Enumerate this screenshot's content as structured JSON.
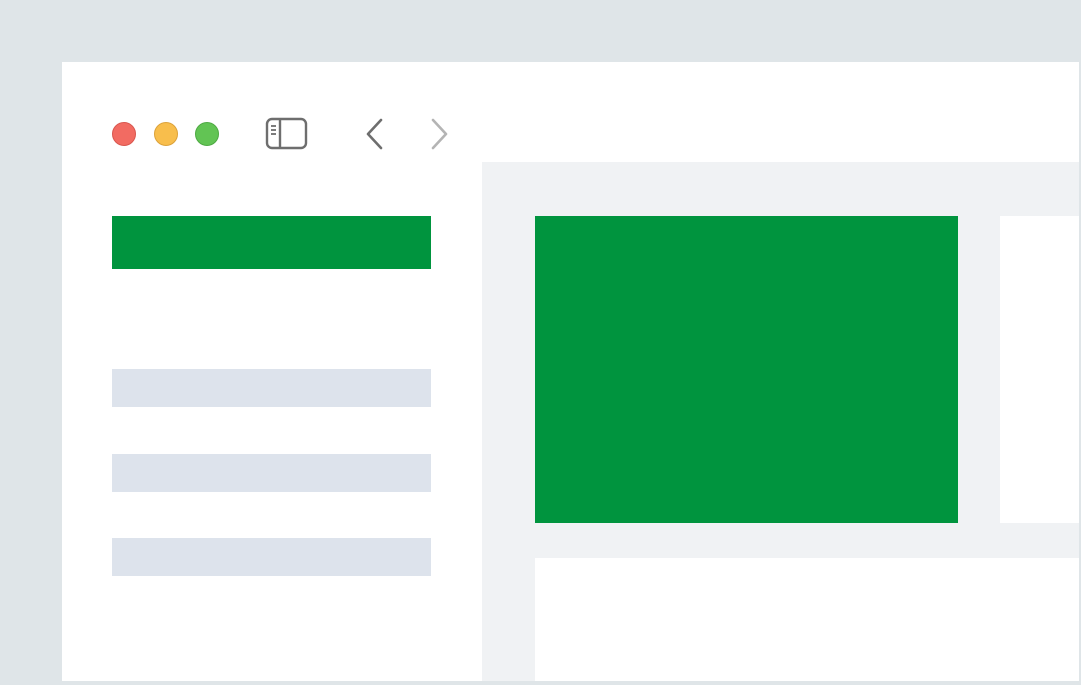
{
  "colors": {
    "backdrop": "#dfe5e8",
    "window_bg": "#ffffff",
    "content_bg": "#f0f2f4",
    "accent_green": "#00943e",
    "placeholder_gray": "#dde3ec",
    "icon_gray": "#6e6e6e",
    "icon_gray_disabled": "#b4b4b4",
    "traffic_close": "#f26b62",
    "traffic_minimize": "#f8be4c",
    "traffic_maximize": "#62c454"
  },
  "titlebar": {
    "window_controls": [
      "close",
      "minimize",
      "maximize"
    ],
    "icons": [
      "sidebar-toggle-icon",
      "chevron-left-icon",
      "chevron-right-icon"
    ]
  },
  "sidebar": {
    "items": [
      {
        "state": "active"
      },
      {
        "state": "placeholder"
      },
      {
        "state": "placeholder"
      },
      {
        "state": "placeholder"
      }
    ]
  },
  "content": {
    "cards": [
      "primary",
      "secondary",
      "bottom"
    ]
  }
}
